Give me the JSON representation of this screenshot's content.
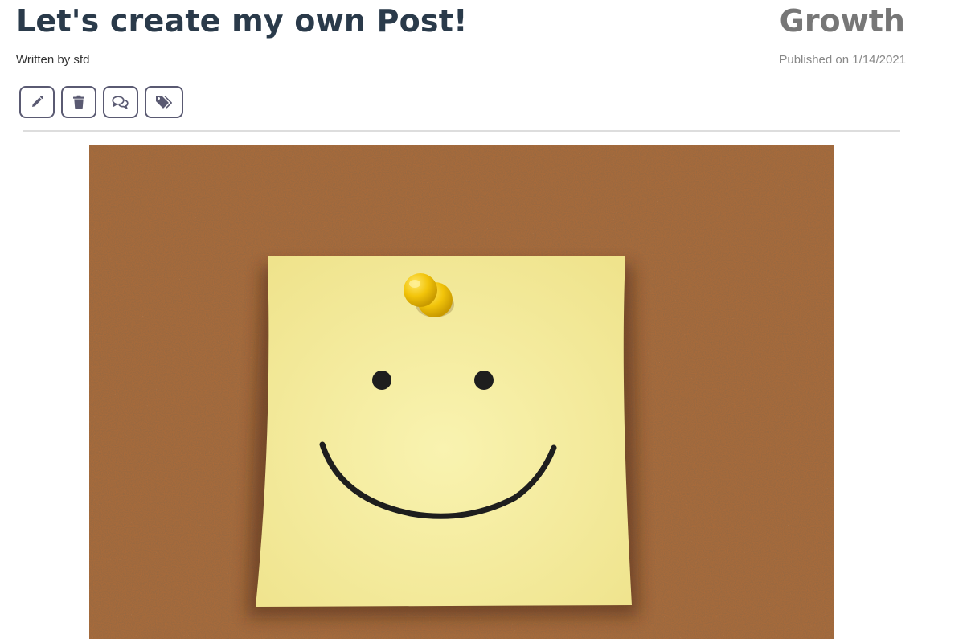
{
  "post": {
    "title": "Let's create my own Post!",
    "category": "Growth",
    "author_text": "Written by sfd",
    "published_text": "Published on 1/14/2021"
  },
  "actions": [
    {
      "icon": "pencil-icon",
      "name": "edit"
    },
    {
      "icon": "trash-icon",
      "name": "delete"
    },
    {
      "icon": "comments-icon",
      "name": "comments"
    },
    {
      "icon": "tags-icon",
      "name": "tags"
    }
  ],
  "image": {
    "subject": "smiley-sticky-note",
    "colors": {
      "cork": "#a86a3a",
      "note": "#f5ee9e",
      "pin": "#f2c40a"
    }
  },
  "colors": {
    "title": "#2a3a4a",
    "category": "#777777",
    "button_border": "#5a5a72",
    "divider": "#dddddd"
  }
}
